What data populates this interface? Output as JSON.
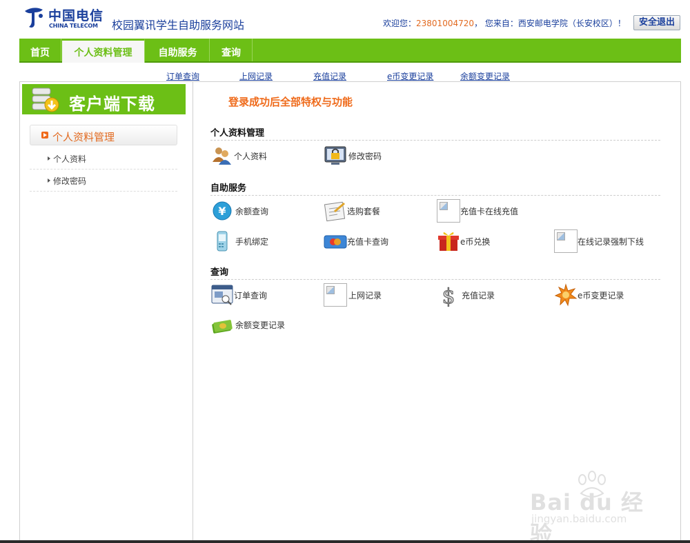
{
  "header": {
    "logo_cn": "中国电信",
    "logo_en": "CHINA TELECOM",
    "site_title": "校园翼讯学生自助服务网站",
    "welcome_prefix": "欢迎您：",
    "phone": "23801004720",
    "welcome_suffix": "， 您来自：西安邮电学院（长安校区）！",
    "logout_label": "安全退出"
  },
  "nav": {
    "items": [
      {
        "label": "首页"
      },
      {
        "label": "个人资料管理"
      },
      {
        "label": "自助服务"
      },
      {
        "label": "查询"
      }
    ],
    "active_index": 1
  },
  "subnav": {
    "links": [
      "订单查询",
      "上网记录",
      "充值记录",
      "e币变更记录",
      "余额变更记录"
    ]
  },
  "sidebar": {
    "download_label": "客户端下载",
    "section_title": "个人资料管理",
    "links": [
      "个人资料",
      "修改密码"
    ]
  },
  "main": {
    "headline": "登录成功后全部特权与功能",
    "sections": [
      {
        "title": "个人资料管理",
        "items": [
          {
            "label": "个人资料",
            "icon": "users-icon"
          },
          {
            "label": "修改密码",
            "icon": "lock-monitor-icon"
          }
        ]
      },
      {
        "title": "自助服务",
        "items": [
          {
            "label": "余额查询",
            "icon": "yen-coin-icon"
          },
          {
            "label": "选购套餐",
            "icon": "package-form-icon"
          },
          {
            "label": "充值卡在线充值",
            "icon": "broken-image-icon"
          },
          {
            "label": "手机绑定",
            "icon": "mobile-phone-icon"
          },
          {
            "label": "充值卡查询",
            "icon": "credit-card-icon"
          },
          {
            "label": "e币兑换",
            "icon": "gift-box-icon"
          },
          {
            "label": "在线记录强制下线",
            "icon": "broken-image-icon"
          }
        ]
      },
      {
        "title": "查询",
        "items": [
          {
            "label": "订单查询",
            "icon": "order-window-icon"
          },
          {
            "label": "上网记录",
            "icon": "broken-image-icon"
          },
          {
            "label": "充值记录",
            "icon": "dollar-sign-icon"
          },
          {
            "label": "e币变更记录",
            "icon": "orange-star-icon"
          },
          {
            "label": "余额变更记录",
            "icon": "money-bills-icon"
          }
        ]
      }
    ]
  },
  "watermark": {
    "brand": "Bai du 经验",
    "domain": "jingyan.baidu.com"
  },
  "colors": {
    "brand_green": "#6cbf16",
    "accent_orange": "#ef6a1a",
    "telecom_blue": "#1a3f9c"
  }
}
